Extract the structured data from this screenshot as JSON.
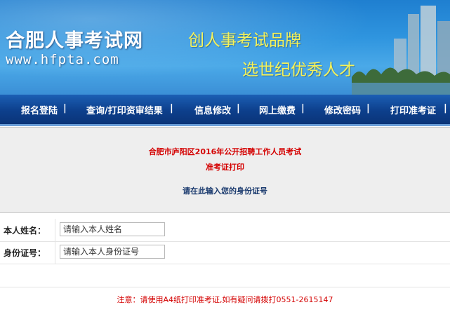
{
  "header": {
    "logo_text": "合肥人事考试网",
    "logo_url": "www.hfpta.com",
    "slogan_line1": "创人事考试品牌",
    "slogan_line2": "选世纪优秀人才"
  },
  "nav": {
    "items": [
      {
        "label": "报名登陆"
      },
      {
        "label": "查询/打印资审结果"
      },
      {
        "label": "信息修改"
      },
      {
        "label": "网上缴费"
      },
      {
        "label": "修改密码"
      },
      {
        "label": "打印准考证"
      }
    ],
    "separator": "|"
  },
  "notice": {
    "exam_title": "合肥市庐阳区2016年公开招聘工作人员考试",
    "exam_subtitle": "准考证打印",
    "prompt": "请在此输入您的身份证号"
  },
  "form": {
    "name_label": "本人姓名：",
    "name_placeholder": "请输入本人姓名",
    "id_label": "身份证号：",
    "id_placeholder": "请输入本人身份证号"
  },
  "footer": {
    "note": "注意：请使用A4纸打印准考证,如有疑问请拨打0551-2615147"
  },
  "colors": {
    "banner_blue": "#2f95df",
    "nav_blue": "#0d3f8c",
    "slogan_yellow": "#f5f25a",
    "notice_red": "#d40000",
    "prompt_blue": "#1a3a6e"
  }
}
